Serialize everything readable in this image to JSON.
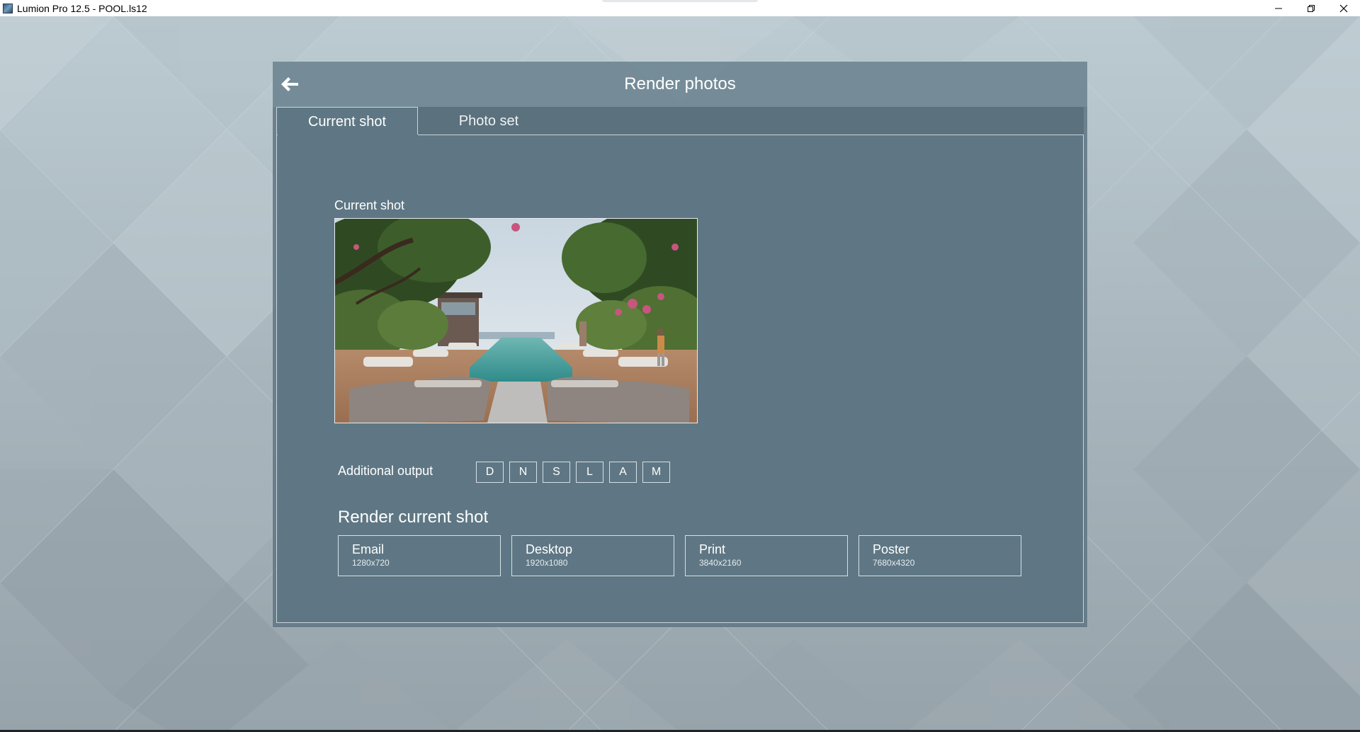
{
  "window": {
    "title": "Lumion Pro 12.5 - POOL.ls12",
    "icon": "lumion-app-icon",
    "controls": [
      "minimize-icon",
      "restore-icon",
      "close-icon"
    ]
  },
  "dialog": {
    "title": "Render photos",
    "back_icon": "arrow-left-icon",
    "tabs": [
      {
        "label": "Current shot",
        "active": true
      },
      {
        "label": "Photo set",
        "active": false
      }
    ]
  },
  "current_shot": {
    "label": "Current shot",
    "preview": "pool-resort-render-thumbnail"
  },
  "additional_output": {
    "label": "Additional output",
    "buttons": [
      "D",
      "N",
      "S",
      "L",
      "A",
      "M"
    ]
  },
  "render": {
    "heading": "Render current shot",
    "presets": [
      {
        "name": "Email",
        "resolution": "1280x720"
      },
      {
        "name": "Desktop",
        "resolution": "1920x1080"
      },
      {
        "name": "Print",
        "resolution": "3840x2160"
      },
      {
        "name": "Poster",
        "resolution": "7680x4320"
      }
    ]
  },
  "colors": {
    "dialog_bg": "#5f7784",
    "header_bg": "#78909c",
    "border": "#c9d5db",
    "text": "#ffffff"
  }
}
